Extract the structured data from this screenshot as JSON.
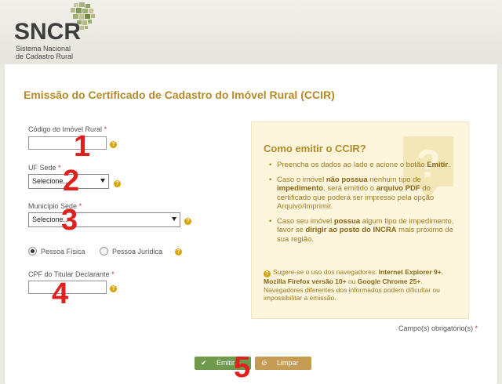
{
  "header": {
    "logo_text": "SNCR",
    "logo_sub_line1": "Sistema Nacional",
    "logo_sub_line2": "de Cadastro Rural"
  },
  "page_title": "Emissão do Certificado de Cadastro do Imóvel Rural (CCIR)",
  "form": {
    "codigo_label": "Código do Imóvel Rural",
    "codigo_value": "",
    "uf_label": "UF Sede",
    "uf_selected": "Selecione...",
    "municipio_label": "Município Sede",
    "municipio_selected": "Selecione...",
    "radio_pf_label": "Pessoa Física",
    "radio_pj_label": "Pessoa Jurídica",
    "radio_selected": "Pessoa Física",
    "cpf_label": "CPF do Titular Declarante",
    "cpf_value": "",
    "required_mark": "*",
    "help_glyph": "?"
  },
  "info": {
    "title": "Como emitir o CCIR?",
    "b1_part1": "Preencha os dados ao lado e acione o botão ",
    "b1_bold": "Emitir",
    "b1_part2": ".",
    "b2_part1": "Caso o imóvel ",
    "b2_bold1": "não possua",
    "b2_part2": " nenhum tipo de ",
    "b2_bold2": "impedimento",
    "b2_part3": ", será emitido o ",
    "b2_bold3": "arquivo PDF",
    "b2_part4": " do certificado que poderá ser impresso pela opção Arquivo/Imprimir.",
    "b3_part1": "Caso seu imóvel ",
    "b3_bold1": "possua",
    "b3_part2": " algum tipo de impedimento, favor se ",
    "b3_bold2": "dirigir ao posto do INCRA",
    "b3_part3": " mais próximo de sua região.",
    "note_part1": "Sugere-se o uso dos navegadores: ",
    "note_bold1": "Internet Explorer 9+",
    "note_part2": ", ",
    "note_bold2": "Mozilla Firefox versão 10+",
    "note_part3": " ou ",
    "note_bold3": "Google Chrome 25+",
    "note_part4": ". Navegadores diferentes dos informados podem dificultar ou impossibilitar a emissão."
  },
  "required_note": "Campo(s) obrigatório(s)",
  "buttons": {
    "emitir": "Emitir",
    "limpar": "Limpar"
  },
  "annotations": [
    "1",
    "2",
    "3",
    "4",
    "5"
  ],
  "colors": {
    "accent": "#b58a28",
    "emitir_bg": "#6e9a4c",
    "limpar_bg": "#c69c54",
    "annotation_red": "#e0201c",
    "help_icon": "#d9a400"
  },
  "icons": {
    "emitir": "check-icon",
    "limpar": "clear-icon",
    "info": "question-bubble-icon",
    "logo": "map-mosaic-logo"
  }
}
